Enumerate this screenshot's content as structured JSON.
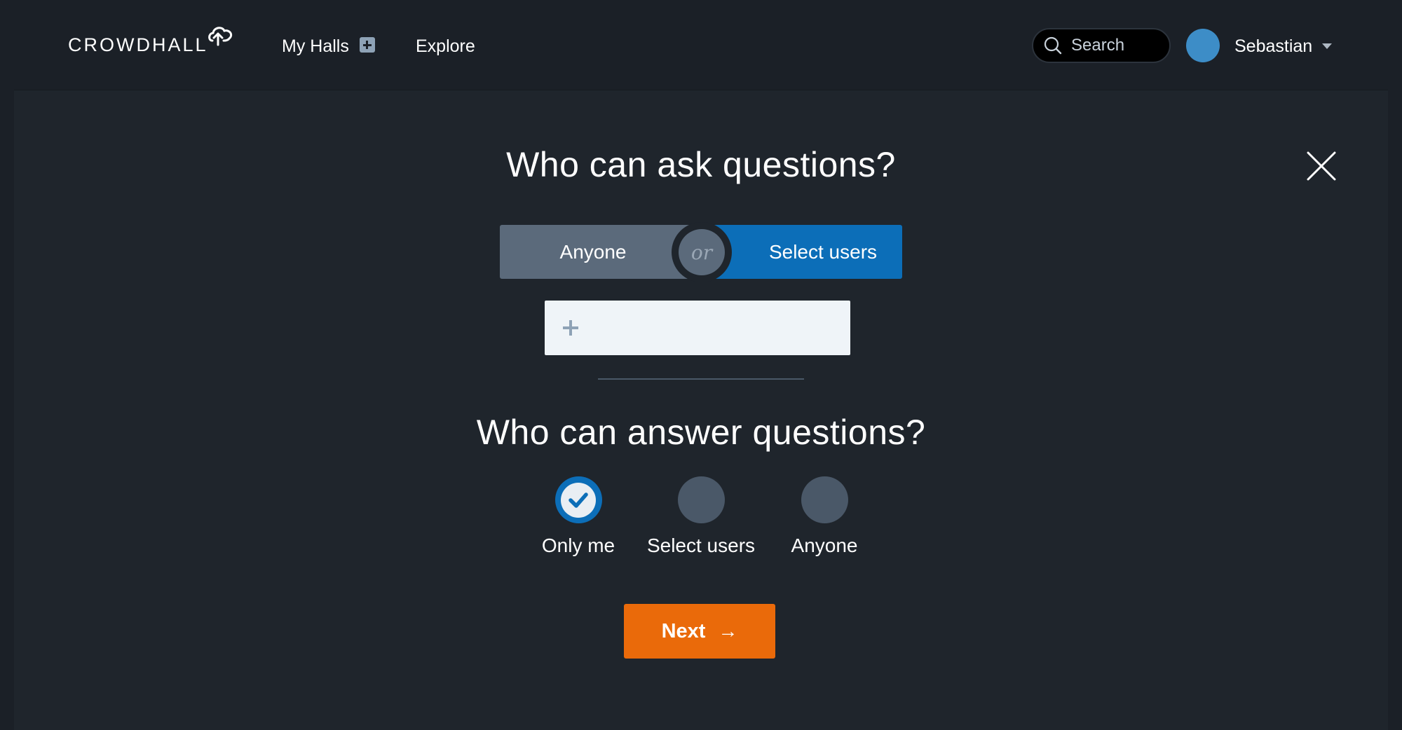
{
  "header": {
    "logo_text": "CROWDHALL",
    "nav": {
      "my_halls": "My Halls",
      "explore": "Explore"
    },
    "search": {
      "label": "Search"
    },
    "user": {
      "name": "Sebastian"
    }
  },
  "ask_section": {
    "title": "Who can ask questions?",
    "toggle": {
      "left_label": "Anyone",
      "separator": "or",
      "right_label": "Select users",
      "selected": "Select users"
    }
  },
  "answer_section": {
    "title": "Who can answer questions?",
    "options": [
      {
        "label": "Only me",
        "checked": true
      },
      {
        "label": "Select users",
        "checked": false
      },
      {
        "label": "Anyone",
        "checked": false
      }
    ]
  },
  "actions": {
    "next_label": "Next",
    "next_arrow": "→"
  },
  "colors": {
    "accent_blue": "#0c6eb8",
    "next_orange": "#ea6a0a",
    "toggle_inactive": "#5b6a7b",
    "background": "#1f252c"
  },
  "icons": [
    "crowdhall-logo-icon",
    "plus-icon",
    "search-icon",
    "chevron-down-icon",
    "close-icon",
    "checkmark-icon",
    "arrow-right-icon"
  ]
}
